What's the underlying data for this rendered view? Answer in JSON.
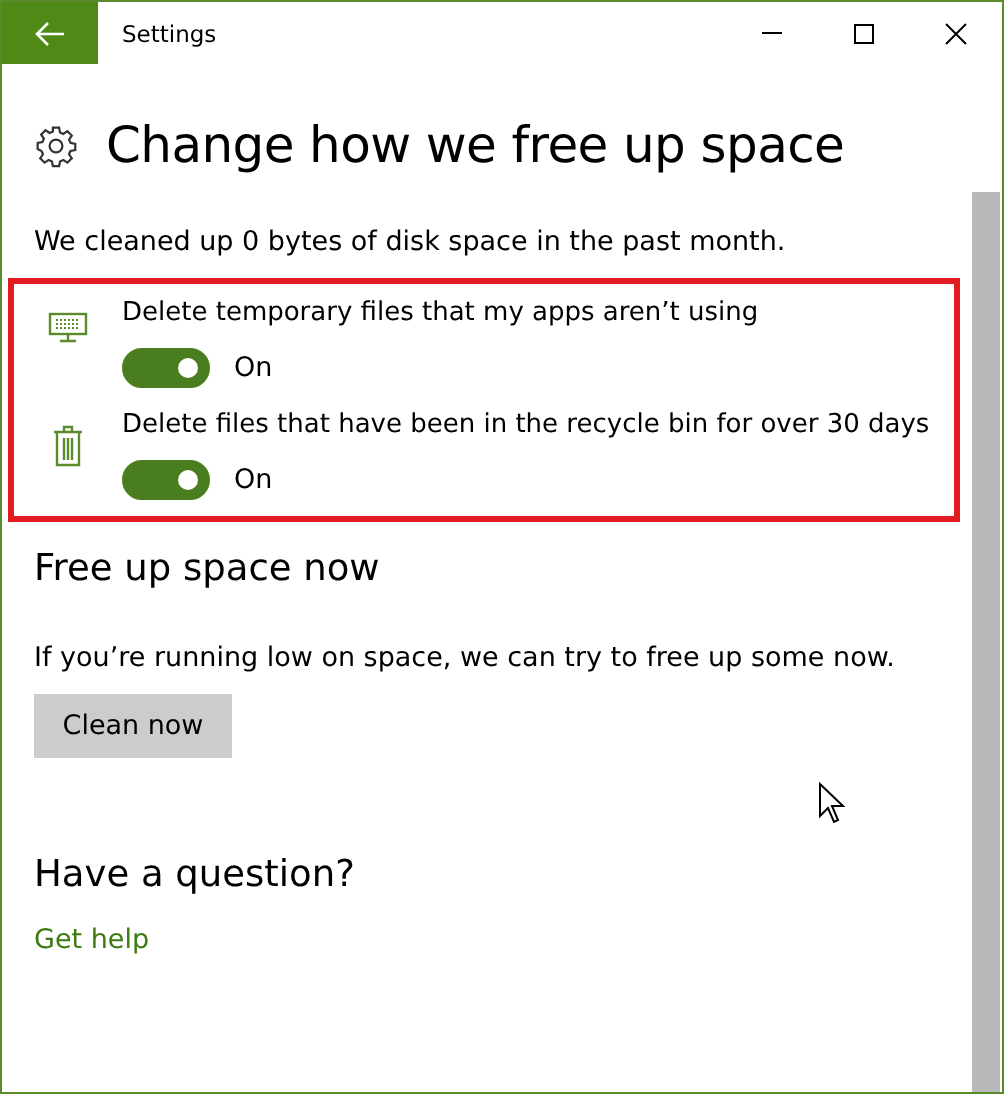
{
  "window": {
    "title": "Settings"
  },
  "page": {
    "title": "Change how we free up space",
    "summary": "We cleaned up 0 bytes of disk space in the past month."
  },
  "options": [
    {
      "kind": "temp",
      "label": "Delete temporary files that my apps aren’t using",
      "on": true,
      "state": "On"
    },
    {
      "kind": "recycle",
      "label": "Delete files that have been in the recycle bin for over 30 days",
      "on": true,
      "state": "On"
    }
  ],
  "free_now": {
    "heading": "Free up space now",
    "text": "If you’re running low on space, we can try to free up some now.",
    "button": "Clean now"
  },
  "help": {
    "heading": "Have a question?",
    "link": "Get help"
  }
}
